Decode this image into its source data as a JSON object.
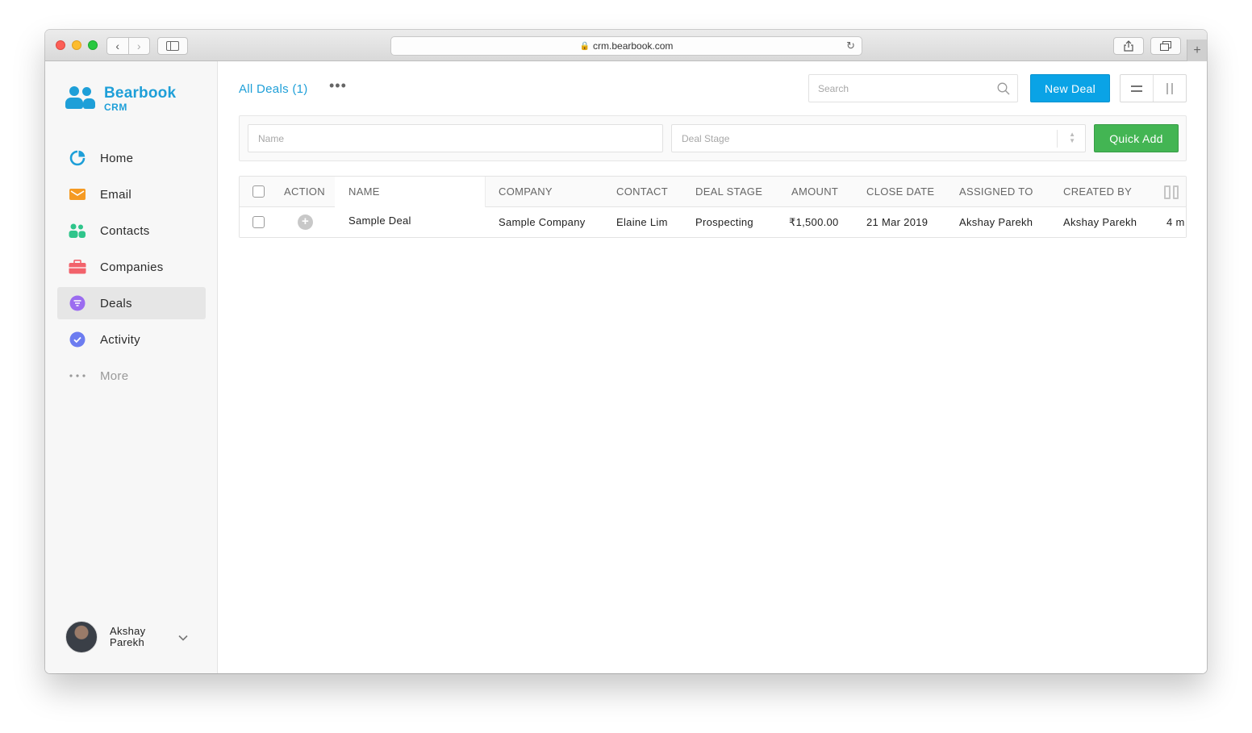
{
  "browser": {
    "url": "crm.bearbook.com",
    "new_tab": "+"
  },
  "app": {
    "logo_name": "Bearbook",
    "logo_sub": "CRM"
  },
  "sidebar": {
    "items": [
      {
        "label": "Home",
        "icon": "pie-chart-icon",
        "color": "#1e9fd8"
      },
      {
        "label": "Email",
        "icon": "envelope-icon",
        "color": "#f59a23"
      },
      {
        "label": "Contacts",
        "icon": "people-icon",
        "color": "#2fc58b"
      },
      {
        "label": "Companies",
        "icon": "briefcase-icon",
        "color": "#f2626b"
      },
      {
        "label": "Deals",
        "icon": "deal-filter-icon",
        "color": "#9b6cf0",
        "active": true
      },
      {
        "label": "Activity",
        "icon": "check-circle-icon",
        "color": "#6c7cf0"
      },
      {
        "label": "More",
        "icon": "ellipsis-icon",
        "color": "#999999"
      }
    ],
    "user": {
      "name": "Akshay Parekh"
    }
  },
  "header": {
    "view_title": "All Deals (1)",
    "more": "•••",
    "search_placeholder": "Search",
    "new_deal_label": "New Deal"
  },
  "filters": {
    "name_placeholder": "Name",
    "stage_placeholder": "Deal Stage",
    "quick_add_label": "Quick Add"
  },
  "table": {
    "columns": [
      "ACTION",
      "NAME",
      "COMPANY",
      "CONTACT",
      "DEAL STAGE",
      "AMOUNT",
      "CLOSE DATE",
      "ASSIGNED TO",
      "CREATED BY"
    ],
    "rows": [
      {
        "name": "Sample Deal",
        "company": "Sample Company",
        "contact": "Elaine Lim",
        "stage": "Prospecting",
        "amount": "₹1,500.00",
        "close_date": "21 Mar 2019",
        "assigned_to": "Akshay Parekh",
        "created_by": "Akshay Parekh",
        "created_at": "4 m"
      }
    ]
  },
  "colors": {
    "accent": "#1e9fd8",
    "primary_button": "#0aa3e6",
    "success_button": "#43b553"
  }
}
